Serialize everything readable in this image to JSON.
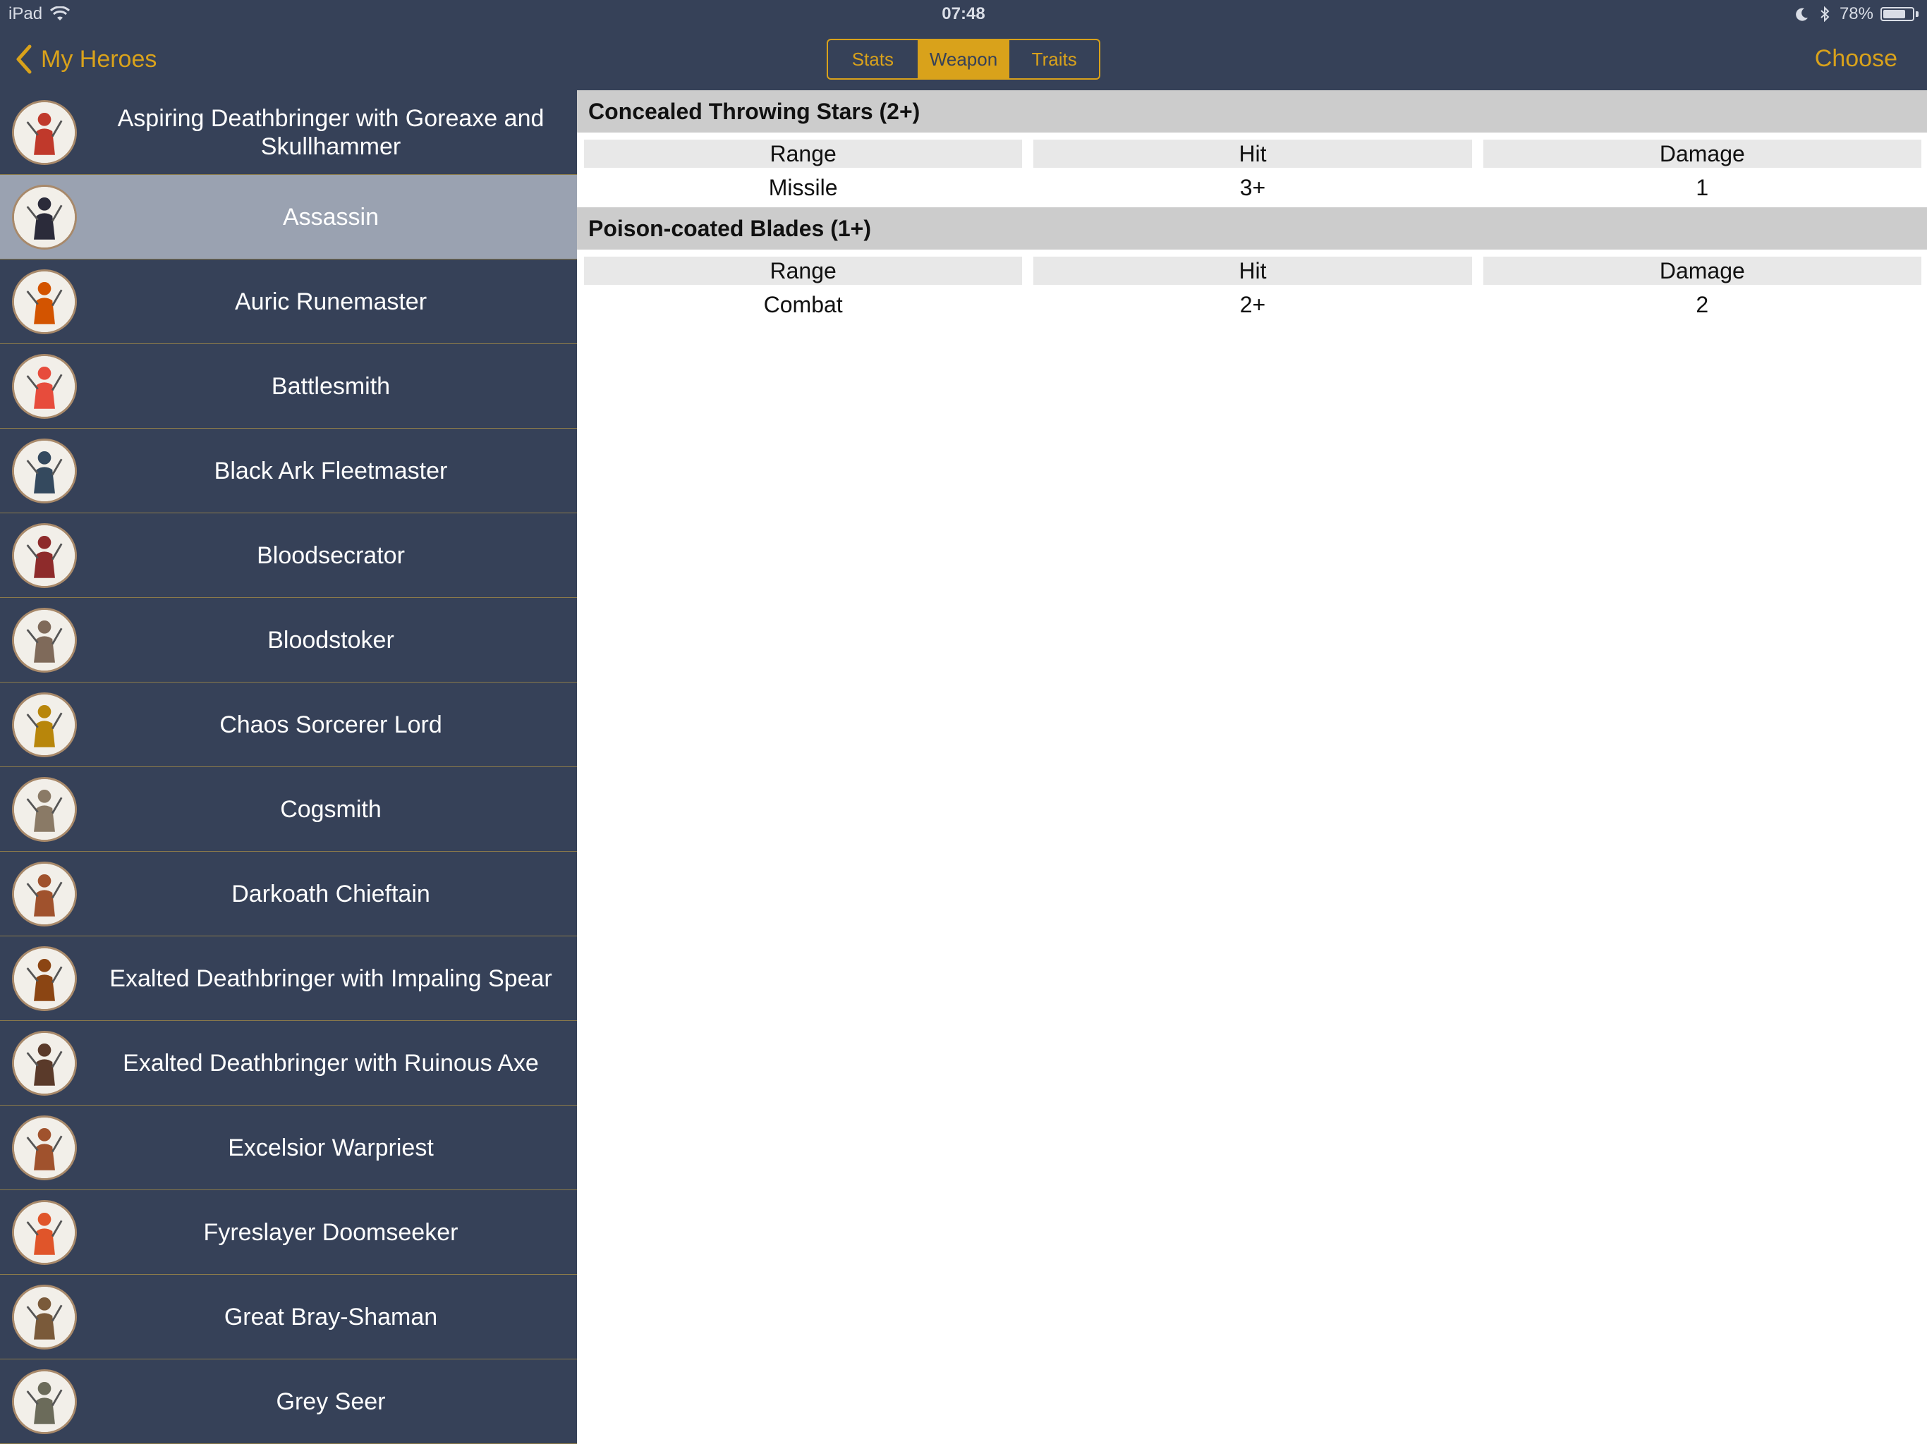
{
  "status": {
    "device": "iPad",
    "time": "07:48",
    "battery": "78%",
    "battery_level": 0.78
  },
  "nav": {
    "back_label": "My Heroes",
    "choose_label": "Choose"
  },
  "tabs": [
    {
      "label": "Stats",
      "active": false
    },
    {
      "label": "Weapon",
      "active": true
    },
    {
      "label": "Traits",
      "active": false
    }
  ],
  "heroes": [
    {
      "name": "Aspiring Deathbringer with Goreaxe and Skullhammer",
      "selected": false,
      "color": "#c0392b"
    },
    {
      "name": "Assassin",
      "selected": true,
      "color": "#2b2b3a"
    },
    {
      "name": "Auric Runemaster",
      "selected": false,
      "color": "#d35400"
    },
    {
      "name": "Battlesmith",
      "selected": false,
      "color": "#e74c3c"
    },
    {
      "name": "Black Ark Fleetmaster",
      "selected": false,
      "color": "#34495e"
    },
    {
      "name": "Bloodsecrator",
      "selected": false,
      "color": "#8e2b2b"
    },
    {
      "name": "Bloodstoker",
      "selected": false,
      "color": "#7f6a5a"
    },
    {
      "name": "Chaos Sorcerer Lord",
      "selected": false,
      "color": "#b8860b"
    },
    {
      "name": "Cogsmith",
      "selected": false,
      "color": "#8a7a66"
    },
    {
      "name": "Darkoath Chieftain",
      "selected": false,
      "color": "#a0522d"
    },
    {
      "name": "Exalted Deathbringer with Impaling Spear",
      "selected": false,
      "color": "#8b4513"
    },
    {
      "name": "Exalted Deathbringer with Ruinous Axe",
      "selected": false,
      "color": "#5a3a2a"
    },
    {
      "name": "Excelsior Warpriest",
      "selected": false,
      "color": "#a0522d"
    },
    {
      "name": "Fyreslayer Doomseeker",
      "selected": false,
      "color": "#e0552a"
    },
    {
      "name": "Great Bray-Shaman",
      "selected": false,
      "color": "#7a5a3a"
    },
    {
      "name": "Grey Seer",
      "selected": false,
      "color": "#6b6b5a"
    }
  ],
  "weapons": [
    {
      "name": "Concealed Throwing Stars (2+)",
      "headers": [
        "Range",
        "Hit",
        "Damage"
      ],
      "values": [
        "Missile",
        "3+",
        "1"
      ]
    },
    {
      "name": "Poison-coated Blades (1+)",
      "headers": [
        "Range",
        "Hit",
        "Damage"
      ],
      "values": [
        "Combat",
        "2+",
        "2"
      ]
    }
  ]
}
